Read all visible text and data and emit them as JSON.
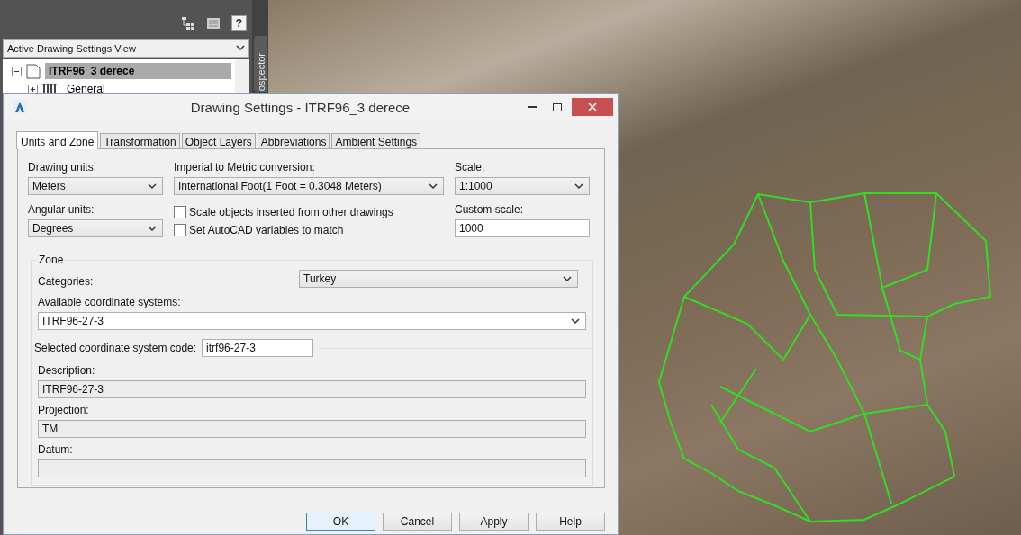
{
  "toolspace": {
    "help_button": "?",
    "view_selector": "Active Drawing Settings View",
    "side_tab": "ospector",
    "tree": [
      {
        "label": "ITRF96_3 derece",
        "expanded": true,
        "selected": true,
        "children": [
          {
            "label": "General",
            "expanded": false,
            "selected": false
          }
        ]
      }
    ]
  },
  "dialog": {
    "title": "Drawing Settings - ITRF96_3 derece",
    "tabs": [
      {
        "label": "Units and Zone",
        "selected": true
      },
      {
        "label": "Transformation",
        "selected": false
      },
      {
        "label": "Object Layers",
        "selected": false
      },
      {
        "label": "Abbreviations",
        "selected": false
      },
      {
        "label": "Ambient Settings",
        "selected": false
      }
    ],
    "drawing_units": {
      "label": "Drawing units:",
      "value": "Meters"
    },
    "imperial_conversion": {
      "label": "Imperial to Metric conversion:",
      "value": "International Foot(1 Foot = 0.3048 Meters)"
    },
    "scale": {
      "label": "Scale:",
      "value": "1:1000"
    },
    "angular_units": {
      "label": "Angular units:",
      "value": "Degrees"
    },
    "checkboxes": [
      {
        "label": "Scale objects inserted from other drawings",
        "checked": false
      },
      {
        "label": "Set AutoCAD variables to match",
        "checked": false
      }
    ],
    "custom_scale": {
      "label": "Custom scale:",
      "value": "1000"
    },
    "zone": {
      "title": "Zone",
      "categories": {
        "label": "Categories:",
        "value": "Turkey"
      },
      "available_systems": {
        "label": "Available coordinate systems:",
        "value": "ITRF96-27-3"
      },
      "selected_code": {
        "label": "Selected coordinate system code:",
        "value": "itrf96-27-3"
      },
      "description": {
        "label": "Description:",
        "value": "ITRF96-27-3"
      },
      "projection": {
        "label": "Projection:",
        "value": "TM"
      },
      "datum": {
        "label": "Datum:"
      }
    },
    "buttons": [
      {
        "label": "OK",
        "default": true
      },
      {
        "label": "Cancel",
        "default": false
      },
      {
        "label": "Apply",
        "default": false
      },
      {
        "label": "Help",
        "default": false
      }
    ]
  }
}
